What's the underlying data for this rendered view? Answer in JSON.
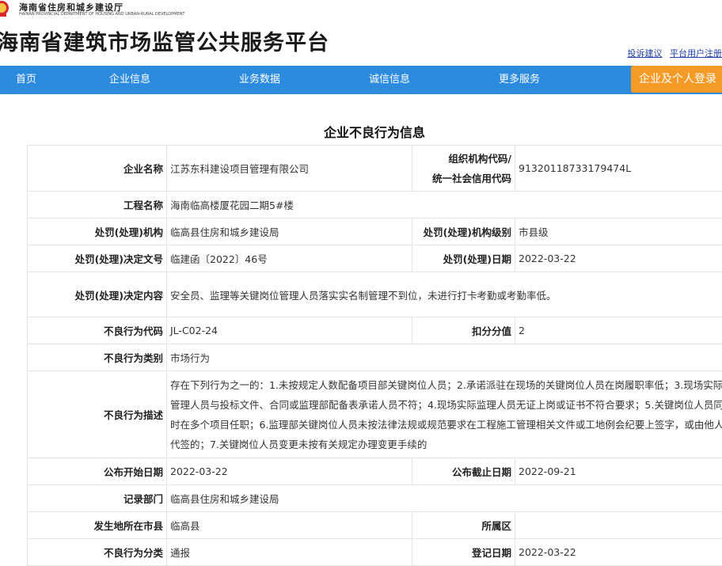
{
  "header": {
    "dept_name": "海南省住房和城乡建设厅",
    "dept_name_en": "HAINAN PROVINCIAL DEPARTMENT OF HOUSING AND URBAN-RURAL DEVELOPMENT",
    "site_title": "海南省建筑市场监管公共服务平台",
    "links": [
      "投诉建议",
      "平台用户注册"
    ]
  },
  "nav": {
    "items": [
      "首页",
      "企业信息",
      "业务数据",
      "诚信信息",
      "更多服务"
    ],
    "login": "企业及个人登录"
  },
  "page": {
    "heading": "企业不良行为信息"
  },
  "record": {
    "company_label": "企业名称",
    "company": "江苏东科建设项目管理有限公司",
    "org_code_label_1": "组织机构代码/",
    "org_code_label_2": "统一社会信用代码",
    "org_code": "91320118733179474L",
    "project_label": "工程名称",
    "project": "海南临高楼厦花园二期5#楼",
    "authority_label": "处罚(处理)机构",
    "authority": "临高县住房和城乡建设局",
    "authority_level_label": "处罚(处理)机构级别",
    "authority_level": "市县级",
    "doc_no_label": "处罚(处理)决定文号",
    "doc_no": "临建函〔2022〕46号",
    "penalty_date_label": "处罚(处理)日期",
    "penalty_date": "2022-03-22",
    "content_label": "处罚(处理)决定内容",
    "content": "安全员、监理等关键岗位管理人员落实实名制管理不到位，未进行打卡考勤或考勤率低。",
    "code_label": "不良行为代码",
    "code": "JL-C02-24",
    "points_label": "扣分分值",
    "points": "2",
    "category_label": "不良行为类别",
    "category": "市场行为",
    "description_label": "不良行为描述",
    "description": "存在下列行为之一的：1.未按规定人数配备项目部关键岗位人员；2.承诺派驻在现场的关键岗位人员在岗履职率低；3.现场实际管理人员与投标文件、合同或监理部配备表承诺人员不符；4.现场实际监理人员无证上岗或证书不符合要求；5.关键岗位人员同时在多个项目任职；6.监理部关键岗位人员未按法律法规或规范要求在工程施工管理相关文件或工地例会纪要上签字，或由他人代签的；7.关键岗位人员变更未按有关规定办理变更手续的",
    "publish_start_label": "公布开始日期",
    "publish_start": "2022-03-22",
    "publish_end_label": "公布截止日期",
    "publish_end": "2022-09-21",
    "record_dept_label": "记录部门",
    "record_dept": "临高县住房和城乡建设局",
    "city_label": "发生地所在市县",
    "city": "临高县",
    "district_label": "所属区",
    "district": "",
    "class_label": "不良行为分类",
    "class": "通报",
    "register_date_label": "登记日期",
    "register_date": "2022-03-22"
  }
}
